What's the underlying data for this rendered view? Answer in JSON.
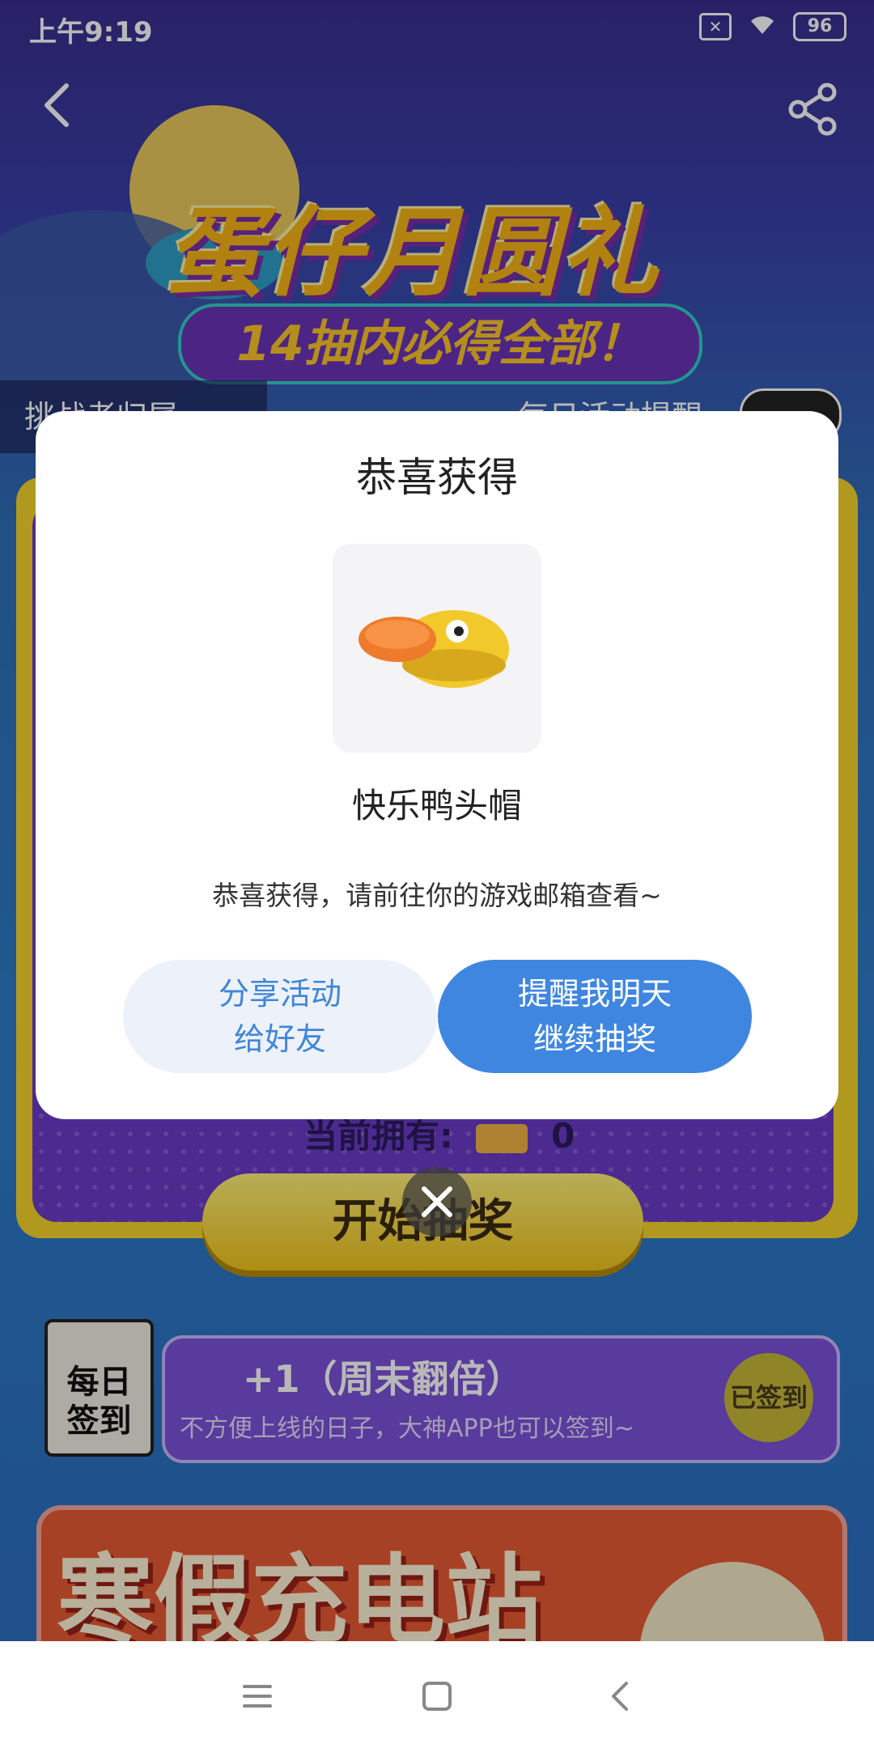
{
  "status_bar": {
    "time": "上午9:19",
    "battery": "96"
  },
  "banner": {
    "title": "蛋仔月圆礼",
    "subtitle": "14抽内必得全部！",
    "left_strip": "挑战者归属",
    "right_strip": "每日活动提醒"
  },
  "lottery": {
    "owned_label": "当前拥有:",
    "owned_count": "0",
    "start_label": "开始抽奖"
  },
  "checkin": {
    "calendar_label_1": "每日",
    "calendar_label_2": "签到",
    "reward_text": "+1（周末翻倍）",
    "subtitle": "不方便上线的日子，大神APP也可以签到~",
    "badge": "已签到"
  },
  "holiday": {
    "title": "寒假充电站"
  },
  "modal": {
    "title": "恭喜获得",
    "prize_name": "快乐鸭头帽",
    "description": "恭喜获得，请前往你的游戏邮箱查看~",
    "share_label_1": "分享活动",
    "share_label_2": "给好友",
    "remind_label_1": "提醒我明天",
    "remind_label_2": "继续抽奖"
  },
  "colors": {
    "primary_blue": "#3f86e0",
    "banner_gold": "#f6b416",
    "lottery_purple": "#6a3bc8"
  },
  "icons": {
    "back": "chevron-left-icon",
    "share": "share-icon",
    "close": "close-icon",
    "prize": "duck-hat-icon"
  }
}
